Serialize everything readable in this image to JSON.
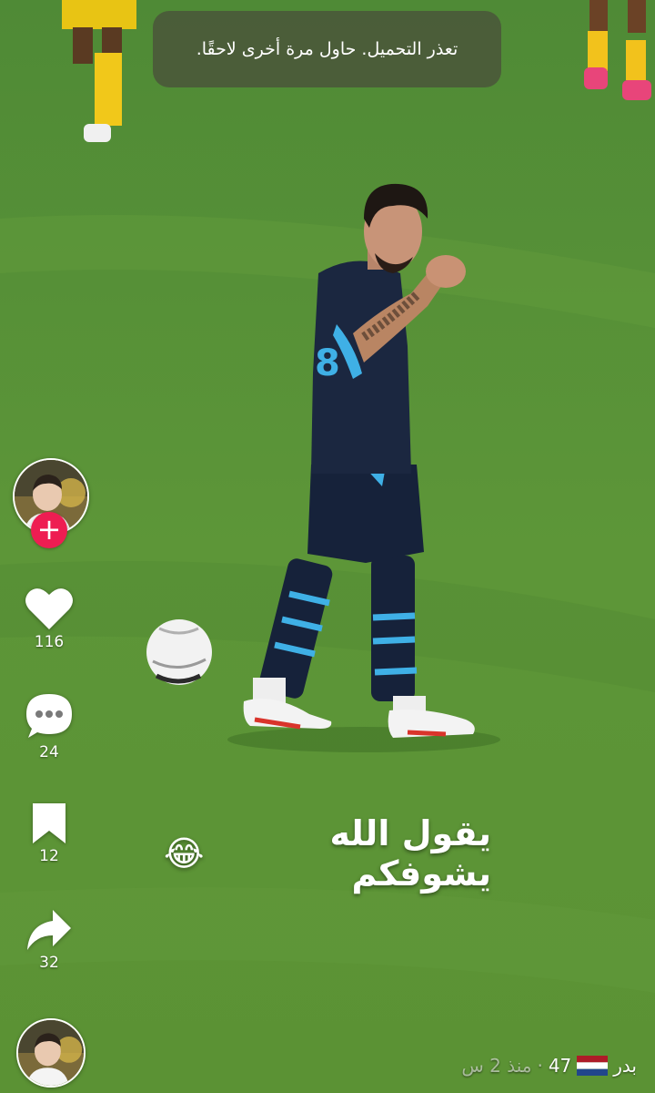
{
  "toast": {
    "message": "تعذر التحميل. حاول مرة أخرى لاحقًا."
  },
  "video": {
    "caption": "يقول الله يشوفكم",
    "caption_emoji": "😂"
  },
  "author": {
    "avatar_icon": "avatar-boy",
    "follow_label": "+"
  },
  "actions": {
    "likes": "116",
    "comments": "24",
    "saves": "12",
    "shares": "32"
  },
  "meta": {
    "username": "بدر",
    "flag_icon": "netherlands-flag",
    "count": "47",
    "separator": "·",
    "time_ago": "منذ 2 س"
  },
  "colors": {
    "follow": "#ee1d52",
    "toast_bg": "#4a563a",
    "pitch": "#5a8f3a"
  }
}
